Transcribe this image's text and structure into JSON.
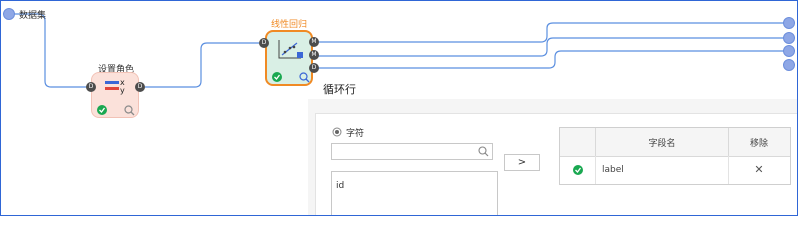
{
  "canvas": {
    "dataset_label": "数据集",
    "colors": {
      "wire": "#5b8fe0",
      "frame": "#2f66d6",
      "check": "#1aa851",
      "accent": "#f08a24"
    }
  },
  "nodes": {
    "set_role": {
      "title": "设置角色",
      "legend_x": "x",
      "legend_y": "y",
      "port_in": "D",
      "port_out": "D",
      "status_icon": "check-circle-icon",
      "search_icon": "search-icon"
    },
    "linear_regression": {
      "title": "线性回归",
      "port_in": "D",
      "ports_out": [
        "M",
        "M",
        "D"
      ],
      "status_icon": "check-circle-icon",
      "search_icon": "search-icon"
    }
  },
  "panel": {
    "title": "循环行",
    "radio_label": "字符",
    "search_placeholder": "",
    "list_items": [
      "id"
    ],
    "move_button": ">",
    "table": {
      "headers": [
        "",
        "字段名",
        "移除"
      ],
      "rows": [
        {
          "status": "check",
          "field": "label",
          "remove": "✕"
        }
      ]
    }
  }
}
